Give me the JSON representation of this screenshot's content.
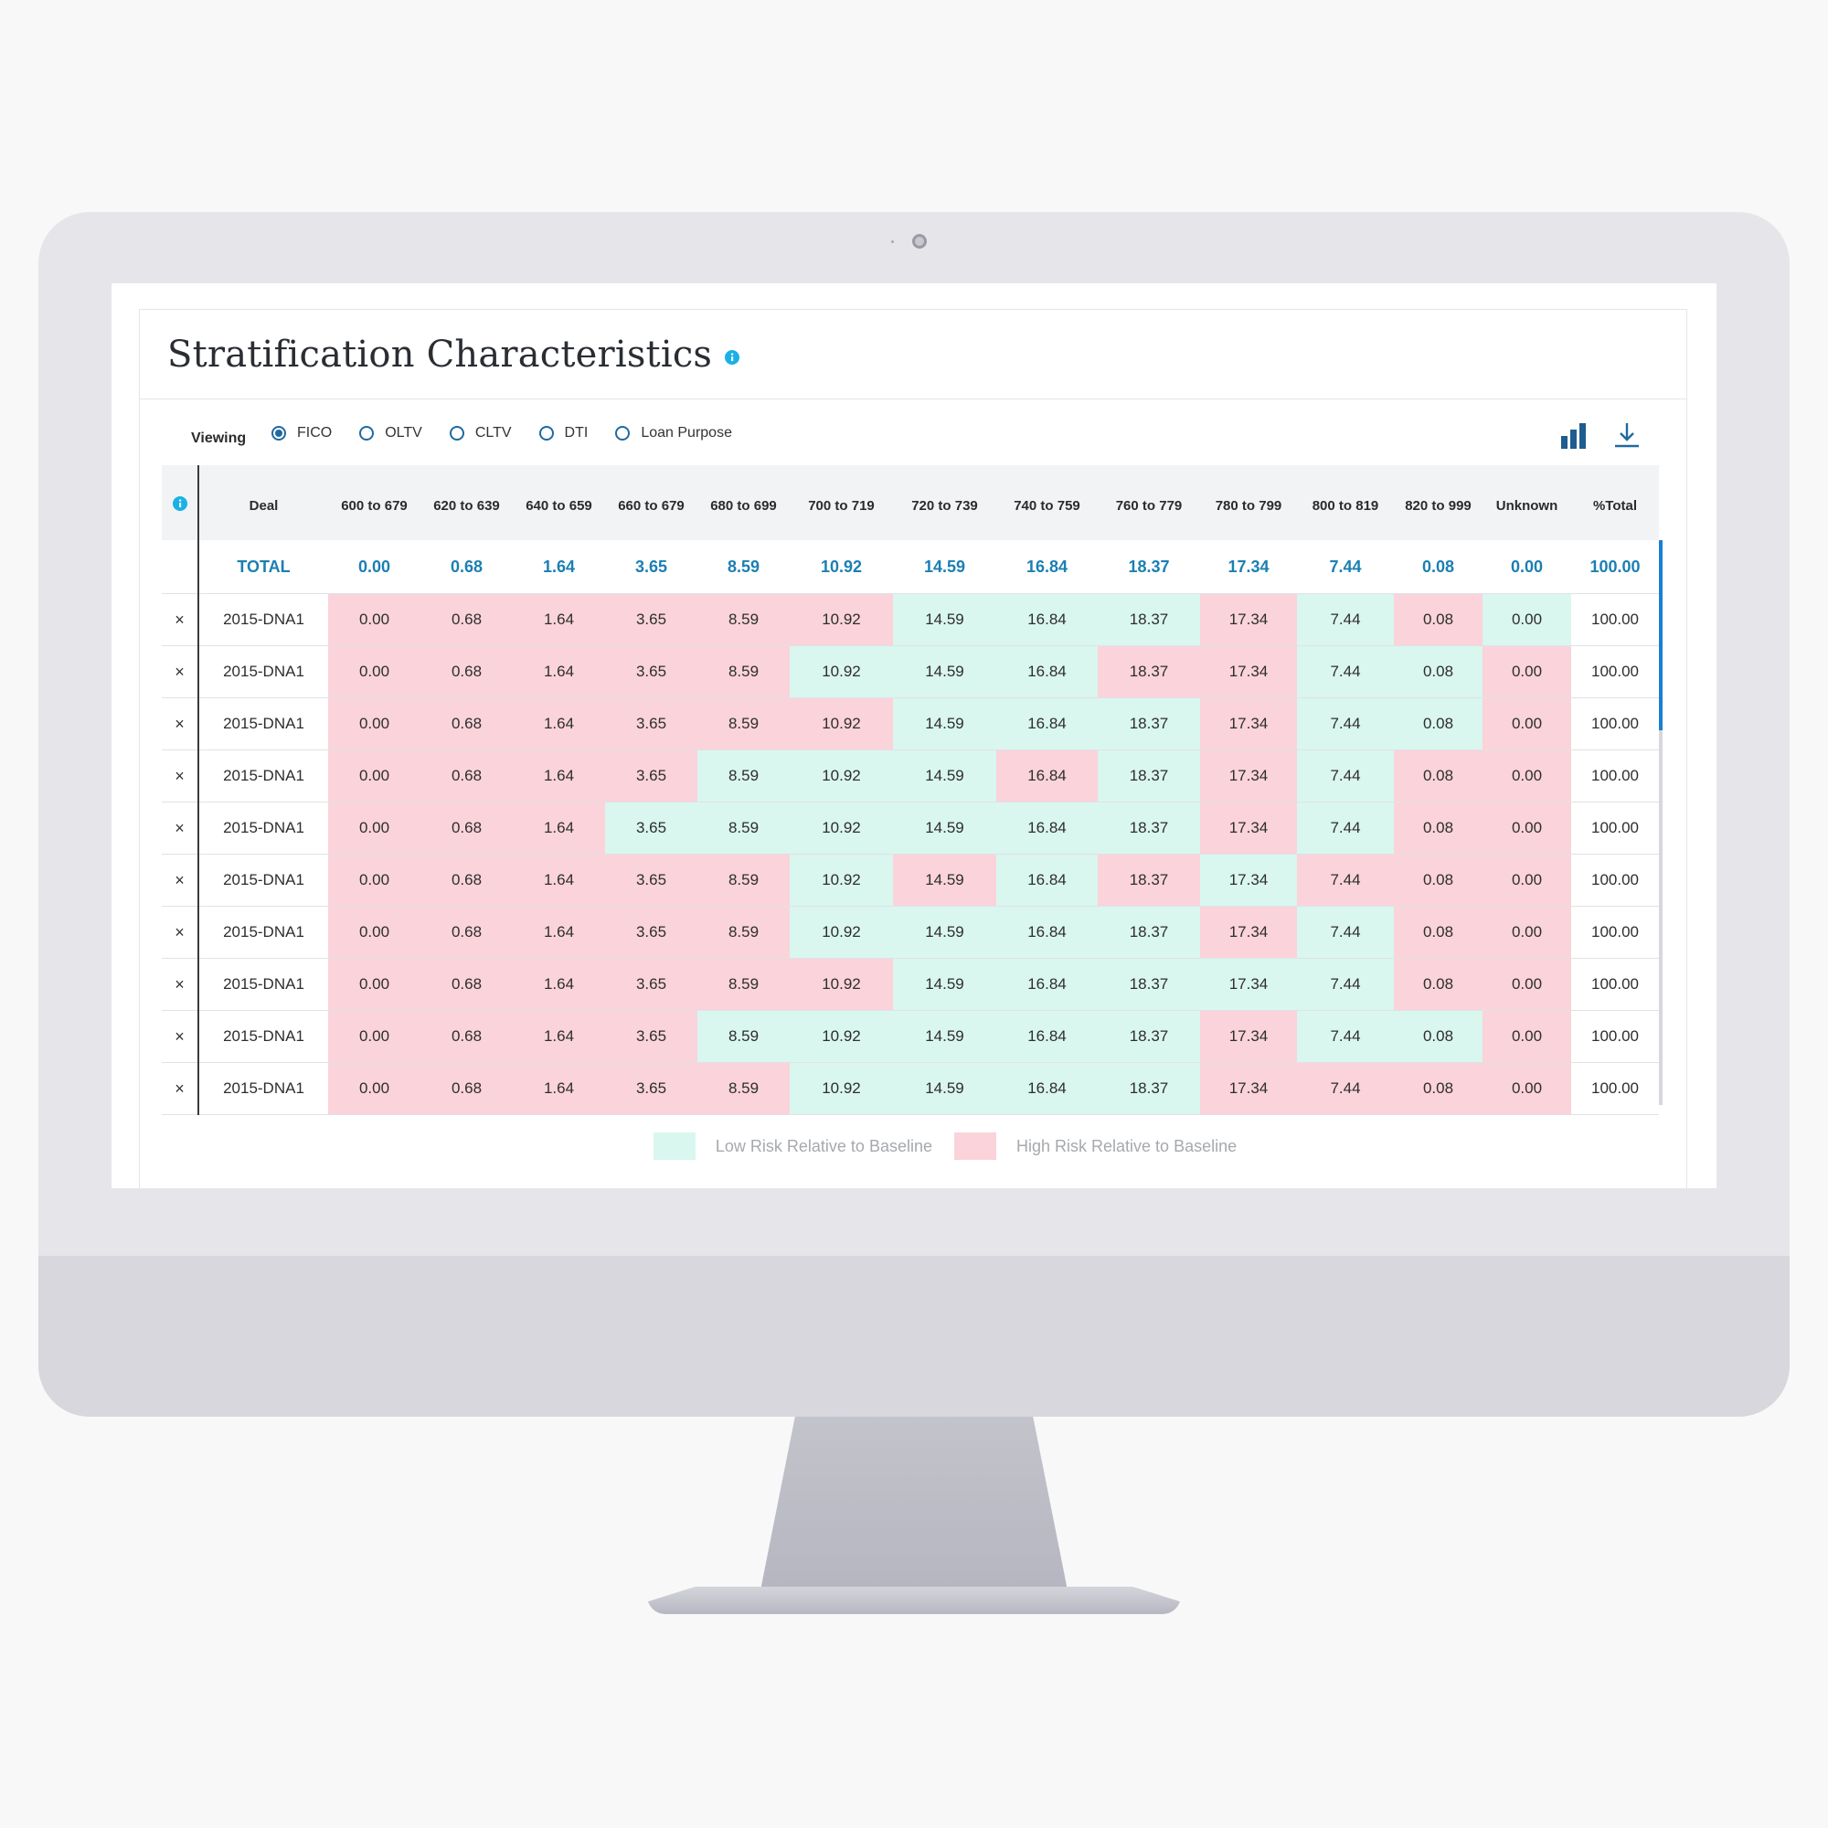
{
  "page": {
    "title": "Stratification Characteristics"
  },
  "controls": {
    "viewing_label": "Viewing",
    "options": [
      {
        "label": "FICO",
        "checked": true
      },
      {
        "label": "OLTV",
        "checked": false
      },
      {
        "label": "CLTV",
        "checked": false
      },
      {
        "label": "DTI",
        "checked": false
      },
      {
        "label": "Loan Purpose",
        "checked": false
      }
    ],
    "chart_icon": "bar-chart-icon",
    "download_icon": "download-icon"
  },
  "table": {
    "columns": [
      "Deal",
      "600 to 679",
      "620 to 639",
      "640 to 659",
      "660 to 679",
      "680 to 699",
      "700 to 719",
      "720 to 739",
      "740 to 759",
      "760 to 779",
      "780 to 799",
      "800 to 819",
      "820 to 999",
      "Unknown",
      "%Total"
    ],
    "total": {
      "label": "TOTAL",
      "values": [
        "0.00",
        "0.68",
        "1.64",
        "3.65",
        "8.59",
        "10.92",
        "14.59",
        "16.84",
        "18.37",
        "17.34",
        "7.44",
        "0.08",
        "0.00",
        "100.00"
      ]
    },
    "remove_glyph": "×",
    "rows": [
      {
        "deal": "2015-DNA1",
        "values": [
          "0.00",
          "0.68",
          "1.64",
          "3.65",
          "8.59",
          "10.92",
          "14.59",
          "16.84",
          "18.37",
          "17.34",
          "7.44",
          "0.08",
          "0.00"
        ],
        "risk": [
          "hi",
          "hi",
          "hi",
          "hi",
          "hi",
          "hi",
          "lo",
          "lo",
          "lo",
          "hi",
          "lo",
          "hi",
          "lo"
        ],
        "pct_total": "100.00"
      },
      {
        "deal": "2015-DNA1",
        "values": [
          "0.00",
          "0.68",
          "1.64",
          "3.65",
          "8.59",
          "10.92",
          "14.59",
          "16.84",
          "18.37",
          "17.34",
          "7.44",
          "0.08",
          "0.00"
        ],
        "risk": [
          "hi",
          "hi",
          "hi",
          "hi",
          "hi",
          "lo",
          "lo",
          "lo",
          "hi",
          "hi",
          "lo",
          "lo",
          "hi"
        ],
        "pct_total": "100.00"
      },
      {
        "deal": "2015-DNA1",
        "values": [
          "0.00",
          "0.68",
          "1.64",
          "3.65",
          "8.59",
          "10.92",
          "14.59",
          "16.84",
          "18.37",
          "17.34",
          "7.44",
          "0.08",
          "0.00"
        ],
        "risk": [
          "hi",
          "hi",
          "hi",
          "hi",
          "hi",
          "hi",
          "lo",
          "lo",
          "lo",
          "hi",
          "lo",
          "lo",
          "hi"
        ],
        "pct_total": "100.00"
      },
      {
        "deal": "2015-DNA1",
        "values": [
          "0.00",
          "0.68",
          "1.64",
          "3.65",
          "8.59",
          "10.92",
          "14.59",
          "16.84",
          "18.37",
          "17.34",
          "7.44",
          "0.08",
          "0.00"
        ],
        "risk": [
          "hi",
          "hi",
          "hi",
          "hi",
          "lo",
          "lo",
          "lo",
          "hi",
          "lo",
          "hi",
          "lo",
          "hi",
          "hi"
        ],
        "pct_total": "100.00"
      },
      {
        "deal": "2015-DNA1",
        "values": [
          "0.00",
          "0.68",
          "1.64",
          "3.65",
          "8.59",
          "10.92",
          "14.59",
          "16.84",
          "18.37",
          "17.34",
          "7.44",
          "0.08",
          "0.00"
        ],
        "risk": [
          "hi",
          "hi",
          "hi",
          "lo",
          "lo",
          "lo",
          "lo",
          "lo",
          "lo",
          "hi",
          "lo",
          "hi",
          "hi"
        ],
        "pct_total": "100.00"
      },
      {
        "deal": "2015-DNA1",
        "values": [
          "0.00",
          "0.68",
          "1.64",
          "3.65",
          "8.59",
          "10.92",
          "14.59",
          "16.84",
          "18.37",
          "17.34",
          "7.44",
          "0.08",
          "0.00"
        ],
        "risk": [
          "hi",
          "hi",
          "hi",
          "hi",
          "hi",
          "lo",
          "hi",
          "lo",
          "hi",
          "lo",
          "hi",
          "hi",
          "hi"
        ],
        "pct_total": "100.00"
      },
      {
        "deal": "2015-DNA1",
        "values": [
          "0.00",
          "0.68",
          "1.64",
          "3.65",
          "8.59",
          "10.92",
          "14.59",
          "16.84",
          "18.37",
          "17.34",
          "7.44",
          "0.08",
          "0.00"
        ],
        "risk": [
          "hi",
          "hi",
          "hi",
          "hi",
          "hi",
          "lo",
          "lo",
          "lo",
          "lo",
          "hi",
          "lo",
          "hi",
          "hi"
        ],
        "pct_total": "100.00"
      },
      {
        "deal": "2015-DNA1",
        "values": [
          "0.00",
          "0.68",
          "1.64",
          "3.65",
          "8.59",
          "10.92",
          "14.59",
          "16.84",
          "18.37",
          "17.34",
          "7.44",
          "0.08",
          "0.00"
        ],
        "risk": [
          "hi",
          "hi",
          "hi",
          "hi",
          "hi",
          "hi",
          "lo",
          "lo",
          "lo",
          "lo",
          "lo",
          "hi",
          "hi"
        ],
        "pct_total": "100.00"
      },
      {
        "deal": "2015-DNA1",
        "values": [
          "0.00",
          "0.68",
          "1.64",
          "3.65",
          "8.59",
          "10.92",
          "14.59",
          "16.84",
          "18.37",
          "17.34",
          "7.44",
          "0.08",
          "0.00"
        ],
        "risk": [
          "hi",
          "hi",
          "hi",
          "hi",
          "lo",
          "lo",
          "lo",
          "lo",
          "lo",
          "hi",
          "lo",
          "lo",
          "hi"
        ],
        "pct_total": "100.00"
      },
      {
        "deal": "2015-DNA1",
        "values": [
          "0.00",
          "0.68",
          "1.64",
          "3.65",
          "8.59",
          "10.92",
          "14.59",
          "16.84",
          "18.37",
          "17.34",
          "7.44",
          "0.08",
          "0.00"
        ],
        "risk": [
          "hi",
          "hi",
          "hi",
          "hi",
          "hi",
          "lo",
          "lo",
          "lo",
          "lo",
          "hi",
          "hi",
          "hi",
          "hi"
        ],
        "pct_total": "100.00"
      }
    ]
  },
  "legend": {
    "low_label": "Low Risk Relative to Baseline",
    "high_label": "High Risk Relative to Baseline"
  },
  "colors": {
    "accent": "#1b7fb3",
    "low_risk": "#d9f6ef",
    "high_risk": "#fbd3da",
    "info": "#1ab1e6"
  }
}
